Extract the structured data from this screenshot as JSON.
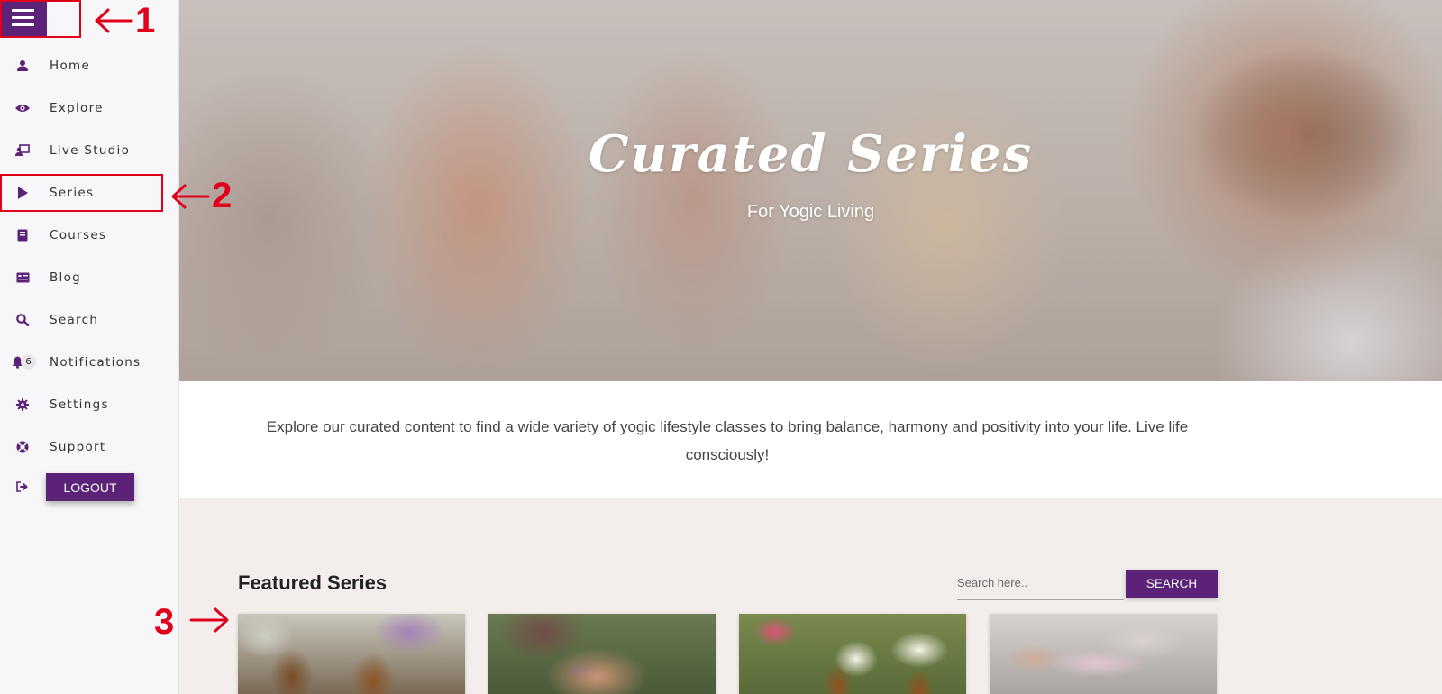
{
  "sidebar": {
    "items": [
      {
        "label": "Home",
        "icon": "user-icon"
      },
      {
        "label": "Explore",
        "icon": "eye-icon"
      },
      {
        "label": "Live Studio",
        "icon": "live-studio-icon"
      },
      {
        "label": "Series",
        "icon": "play-icon"
      },
      {
        "label": "Courses",
        "icon": "book-icon"
      },
      {
        "label": "Blog",
        "icon": "blog-icon"
      },
      {
        "label": "Search",
        "icon": "search-icon"
      },
      {
        "label": "Notifications",
        "icon": "bell-icon",
        "badge": "6"
      },
      {
        "label": "Settings",
        "icon": "gear-icon"
      },
      {
        "label": "Support",
        "icon": "lifebuoy-icon"
      }
    ],
    "logout_label": "LOGOUT"
  },
  "hero": {
    "title": "Curated Series",
    "subtitle": "For Yogic Living"
  },
  "intro": {
    "text": "Explore our curated content to find a wide variety of yogic lifestyle classes to bring balance, harmony and positivity into your life. Live life consciously!"
  },
  "featured": {
    "title": "Featured Series",
    "search_placeholder": "Search here..",
    "search_button": "SEARCH"
  },
  "annotations": {
    "labels": [
      "1",
      "2",
      "3"
    ]
  },
  "colors": {
    "brand": "#5b2277",
    "annotation": "#e0001b",
    "featured_bg": "#f3eeeb"
  }
}
